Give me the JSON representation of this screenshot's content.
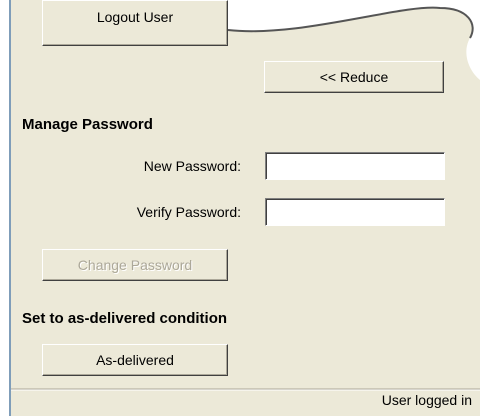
{
  "top": {
    "logout_label": "Logout User"
  },
  "panel": {
    "reduce_label": "<< Reduce"
  },
  "manage_password": {
    "heading": "Manage Password",
    "new_password_label": "New Password:",
    "new_password_value": "",
    "verify_password_label": "Verify Password:",
    "verify_password_value": "",
    "change_button_label": "Change Password"
  },
  "as_delivered": {
    "heading": "Set to as-delivered condition",
    "button_label": "As-delivered"
  },
  "status_bar": {
    "text": "User logged in"
  },
  "colors": {
    "face": "#ece9d8",
    "border": "#7f9db9",
    "window_bg": "#ffffff"
  }
}
